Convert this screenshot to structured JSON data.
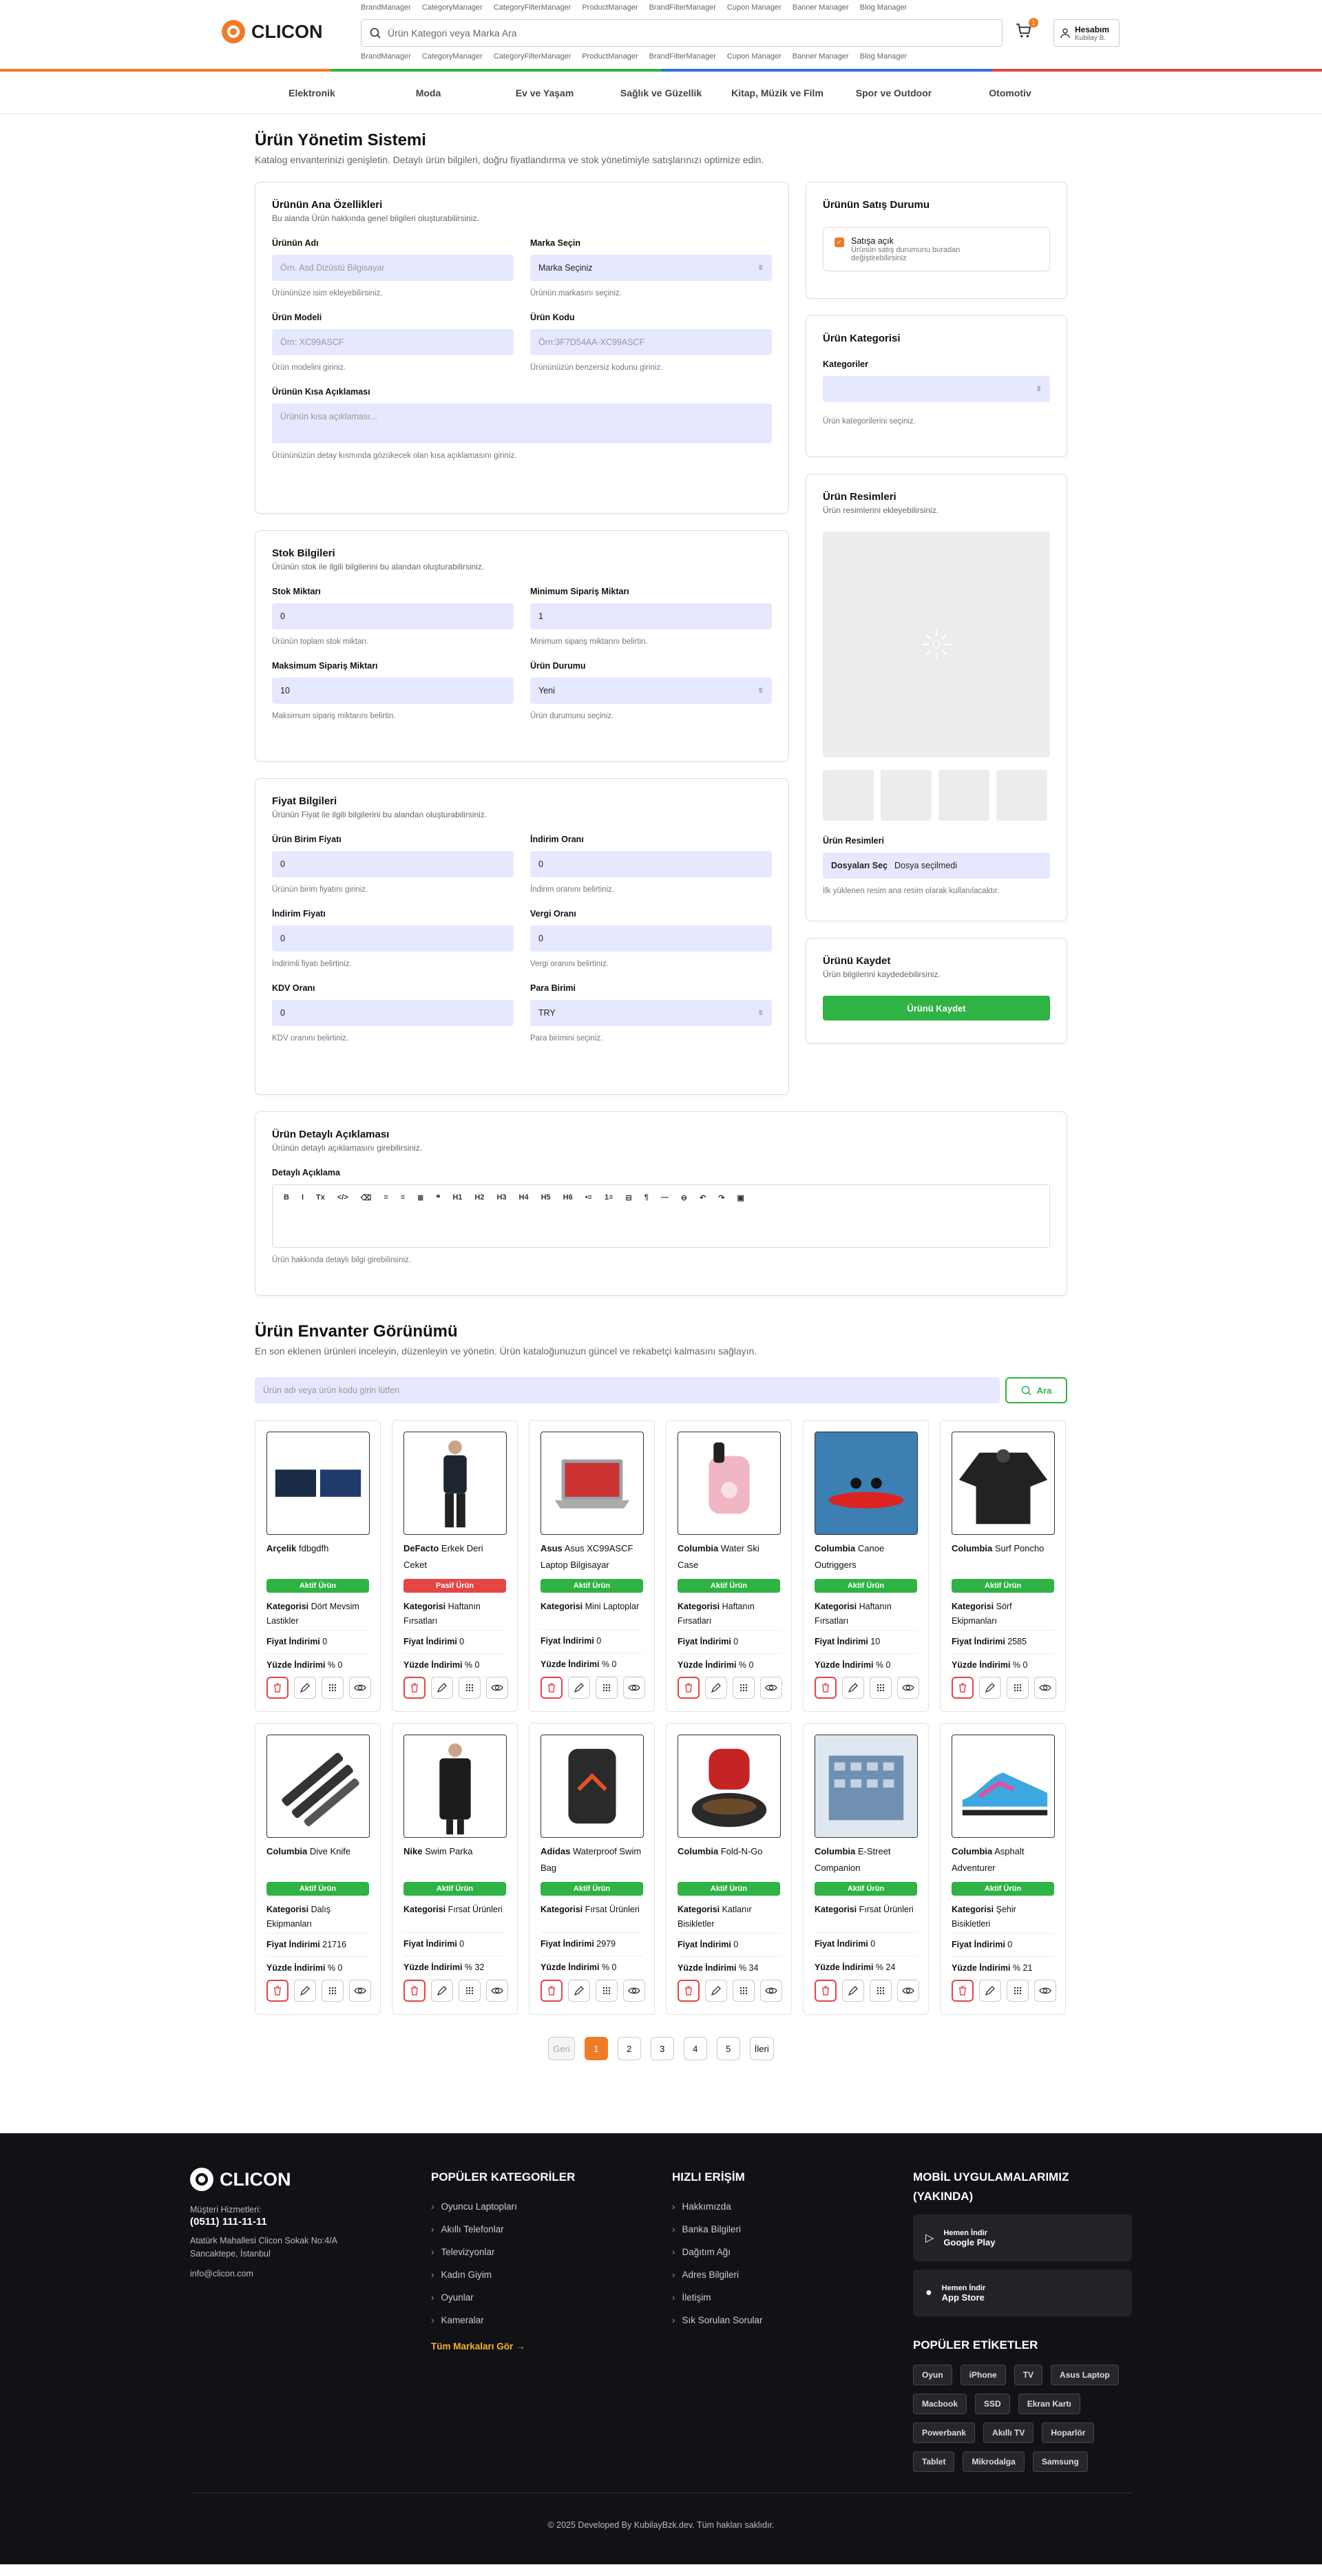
{
  "header": {
    "managers": [
      "BrandManager",
      "CategoryManager",
      "CategoryFilterManager",
      "ProductManager",
      "BrandFilterManager",
      "Cupon Manager",
      "Banner Manager",
      "Blog Manager"
    ],
    "logo": "CLICON",
    "search_placeholder": "Ürün Kategori veya Marka Ara",
    "cart_count": "1",
    "account_title": "Hesabım",
    "account_user": "Kubilay B."
  },
  "categories": [
    "Elektronik",
    "Moda",
    "Ev ve Yaşam",
    "Sağlık ve Güzellik",
    "Kitap, Müzik ve Film",
    "Spor ve Outdoor",
    "Otomotiv"
  ],
  "page": {
    "title": "Ürün Yönetim Sistemi",
    "subtitle": "Katalog envanterinizi genişletin. Detaylı ürün bilgileri, doğru fiyatlandırma ve stok yönetimiyle satışlarınızı optimize edin."
  },
  "basic": {
    "title": "Ürünün Ana Özellikleri",
    "desc": "Bu alanda Ürün hakkında genel bilgileri oluşturabilirsiniz.",
    "name_label": "Ürünün Adı",
    "name_ph": "Örn. Asd Dizüstü Bilgisayar",
    "name_help": "Ürününüze isim ekleyebilirsiniz.",
    "brand_label": "Marka Seçin",
    "brand_val": "Marka Seçiniz",
    "brand_help": "Ürünün markasını seçiniz.",
    "model_label": "Ürün Modeli",
    "model_ph": "Örn: XC99ASCF",
    "model_help": "Ürün modelini giriniz.",
    "code_label": "Ürün Kodu",
    "code_ph": "Örn:3F7D54AA-XC99ASCF",
    "code_help": "Ürününüzün benzersiz kodunu giriniz.",
    "short_label": "Ürünün Kısa Açıklaması",
    "short_ph": "Ürünün kısa açıklaması...",
    "short_help": "Ürününüzün detay kısmında gözükecek olan kısa açıklamasını giriniz."
  },
  "stock": {
    "title": "Stok Bilgileri",
    "desc": "Ürünün stok ile ilgili bilgilerini bu alandan oluşturabilirsiniz.",
    "qty_label": "Stok Miktarı",
    "qty_val": "0",
    "qty_help": "Ürünün toplam stok miktarı.",
    "min_label": "Minimum Sipariş Miktarı",
    "min_val": "1",
    "min_help": "Minimum sipariş miktarını belirtin.",
    "max_label": "Maksimum Sipariş Miktarı",
    "max_val": "10",
    "max_help": "Maksimum sipariş miktarını belirtin.",
    "cond_label": "Ürün Durumu",
    "cond_val": "Yeni",
    "cond_help": "Ürün durumunu seçiniz."
  },
  "price": {
    "title": "Fiyat Bilgileri",
    "desc": "Ürünün Fiyat ile ilgili bilgilerini bu alandan oluşturabilirsiniz.",
    "unit_label": "Ürün Birim Fiyatı",
    "unit_val": "0",
    "unit_help": "Ürünün birim fiyatını giriniz.",
    "drate_label": "İndirim Oranı",
    "drate_val": "0",
    "drate_help": "İndirim oranını belirtiniz.",
    "dprice_label": "İndirim Fiyatı",
    "dprice_val": "0",
    "dprice_help": "İndirimli fiyatı belirtiniz.",
    "tax_label": "Vergi Oranı",
    "tax_val": "0",
    "tax_help": "Vergi oranını belirtiniz.",
    "kdv_label": "KDV Oranı",
    "kdv_val": "0",
    "kdv_help": "KDV oranını belirtiniz.",
    "cur_label": "Para Birimi",
    "cur_val": "TRY",
    "cur_help": "Para birimini seçiniz."
  },
  "detail": {
    "title": "Ürün Detaylı Açıklaması",
    "desc": "Ürünün detaylı açıklamasını girebilirsiniz.",
    "label": "Detaylı Açıklama",
    "help": "Ürün hakkında detaylı bilgi girebilirsiniz.",
    "tools": [
      "B",
      "I",
      "Tx",
      "</>",
      "⌫",
      "≡",
      "≡",
      "≣",
      "❝",
      "H1",
      "H2",
      "H3",
      "H4",
      "H5",
      "H6",
      "•≡",
      "1≡",
      "⊟",
      "¶",
      "—",
      "⊖",
      "↶",
      "↷",
      "▣"
    ]
  },
  "sale": {
    "title": "Ürünün Satış Durumu",
    "check_label": "Satışa açık",
    "check_desc": "Ürünün satış durumunu buradan değiştirebilirsiniz"
  },
  "catbox": {
    "title": "Ürün Kategorisi",
    "label": "Kategoriler",
    "help": "Ürün kategorilerini seçiniz."
  },
  "images": {
    "title": "Ürün Resimleri",
    "desc": "Ürün resimlerini ekleyebilirsiniz.",
    "file_label": "Ürün Resimleri",
    "file_btn": "Dosyaları Seç",
    "file_none": "Dosya seçilmedi",
    "help": "İlk yüklenen resim ana resim olarak kullanılacaktır."
  },
  "save": {
    "title": "Ürünü Kaydet",
    "desc": "Ürün bilgilerini kaydedebilirsiniz.",
    "btn": "Ürünü Kaydet"
  },
  "inventory": {
    "title": "Ürün Envanter Görünümü",
    "subtitle": "En son eklenen ürünleri inceleyin, düzenleyin ve yönetin. Ürün kataloğunuzun güncel ve rekabetçi kalmasını sağlayın.",
    "search_ph": "Ürün adı veya ürün kodu girin lütfen",
    "search_btn": "Ara",
    "cat_label": "Kategorisi",
    "price_label": "Fiyat İndirimi",
    "pct_label": "Yüzde İndirimi",
    "pct_prefix": "%",
    "products": [
      {
        "brand": "Arçelik",
        "name": "fdbgdfh",
        "status": "Aktif Ürün",
        "active": true,
        "category": "Dört Mevsim Lastikler",
        "price": "0",
        "pct": "0",
        "img": "tv",
        "bg": "#1f3a6b"
      },
      {
        "brand": "DeFacto",
        "name": "Erkek Deri Ceket",
        "status": "Pasif Ürün",
        "active": false,
        "category": "Haftanın Fırsatları",
        "price": "0",
        "pct": "0",
        "img": "man",
        "bg": "#1e2530"
      },
      {
        "brand": "Asus",
        "name": "Asus XC99ASCF Laptop Bilgisayar",
        "status": "Aktif Ürün",
        "active": true,
        "category": "Mini Laptoplar",
        "price": "0",
        "pct": "0",
        "img": "laptop",
        "bg": "#9aa2aa"
      },
      {
        "brand": "Columbia",
        "name": "Water Ski Case",
        "status": "Aktif Ürün",
        "active": true,
        "category": "Haftanın Fırsatları",
        "price": "0",
        "pct": "0",
        "img": "bag",
        "bg": "#f0b6c4"
      },
      {
        "brand": "Columbia",
        "name": "Canoe Outriggers",
        "status": "Aktif Ürün",
        "active": true,
        "category": "Haftanın Fırsatları",
        "price": "10",
        "pct": "0",
        "img": "canoe",
        "bg": "#3b7fb3"
      },
      {
        "brand": "Columbia",
        "name": "Surf Poncho",
        "status": "Aktif Ürün",
        "active": true,
        "category": "Sörf Ekipmanları",
        "price": "2585",
        "pct": "0",
        "img": "poncho",
        "bg": "#222"
      },
      {
        "brand": "Columbia",
        "name": "Dive Knife",
        "status": "Aktif Ürün",
        "active": true,
        "category": "Dalış Ekipmanları",
        "price": "21716",
        "pct": "0",
        "img": "knife",
        "bg": "#333"
      },
      {
        "brand": "Nike",
        "name": "Swim Parka",
        "status": "Aktif Ürün",
        "active": true,
        "category": "Fırsat Ürünleri",
        "price": "0",
        "pct": "32",
        "img": "parka",
        "bg": "#1c1c1c"
      },
      {
        "brand": "Adidas",
        "name": "Waterproof Swim Bag",
        "status": "Aktif Ürün",
        "active": true,
        "category": "Fırsat Ürünleri",
        "price": "2979",
        "pct": "0",
        "img": "backpack",
        "bg": "#2a2a2a"
      },
      {
        "brand": "Columbia",
        "name": "Fold-N-Go",
        "status": "Aktif Ürün",
        "active": true,
        "category": "Katlanır Bisikletler",
        "price": "0",
        "pct": "34",
        "img": "redbag",
        "bg": "#c42424"
      },
      {
        "brand": "Columbia",
        "name": "E-Street Companion",
        "status": "Aktif Ürün",
        "active": true,
        "category": "Fırsat Ürünleri",
        "price": "0",
        "pct": "24",
        "img": "building",
        "bg": "#6f90b0"
      },
      {
        "brand": "Columbia",
        "name": "Asphalt Adventurer",
        "status": "Aktif Ürün",
        "active": true,
        "category": "Şehir Bisikletleri",
        "price": "0",
        "pct": "21",
        "img": "shoe",
        "bg": "#3da8e0"
      }
    ]
  },
  "pager": {
    "prev": "Geri",
    "pages": [
      "1",
      "2",
      "3",
      "4",
      "5"
    ],
    "next": "İleri"
  },
  "footer": {
    "logo": "CLICON",
    "support_label": "Müşteri Hizmetleri:",
    "phone": "(0511) 111-11-11",
    "address": "Atatürk Mahallesi Clicon Sokak No:4/A Sancaktepe, İstanbul",
    "email": "info@clicon.com",
    "pop_title": "POPÜLER KATEGORİLER",
    "pop_items": [
      "Oyuncu Laptopları",
      "Akıllı Telefonlar",
      "Televizyonlar",
      "Kadın Giyim",
      "Oyunlar",
      "Kameralar"
    ],
    "all_brands": "Tüm Markaları Gör",
    "quick_title": "HIZLI ERİŞİM",
    "quick_items": [
      "Hakkımızda",
      "Banka Bilgileri",
      "Dağıtım Ağı",
      "Adres Bilgileri",
      "İletişim",
      "Sık Sorulan Sorular"
    ],
    "mobile_title": "MOBİL UYGULAMALARIMIZ (YAKINDA)",
    "apps": [
      {
        "small": "Hemen İndir",
        "big": "Google Play"
      },
      {
        "small": "Hemen İndir",
        "big": "App Store"
      }
    ],
    "tags_title": "POPÜLER ETİKETLER",
    "tags": [
      "Oyun",
      "iPhone",
      "TV",
      "Asus Laptop",
      "Macbook",
      "SSD",
      "Ekran Kartı",
      "Powerbank",
      "Akıllı TV",
      "Hoparlör",
      "Tablet",
      "Mikrodalga",
      "Samsung"
    ],
    "copyright": "© 2025 Developed By KubilayBzk.dev. Tüm hakları saklıdır."
  }
}
